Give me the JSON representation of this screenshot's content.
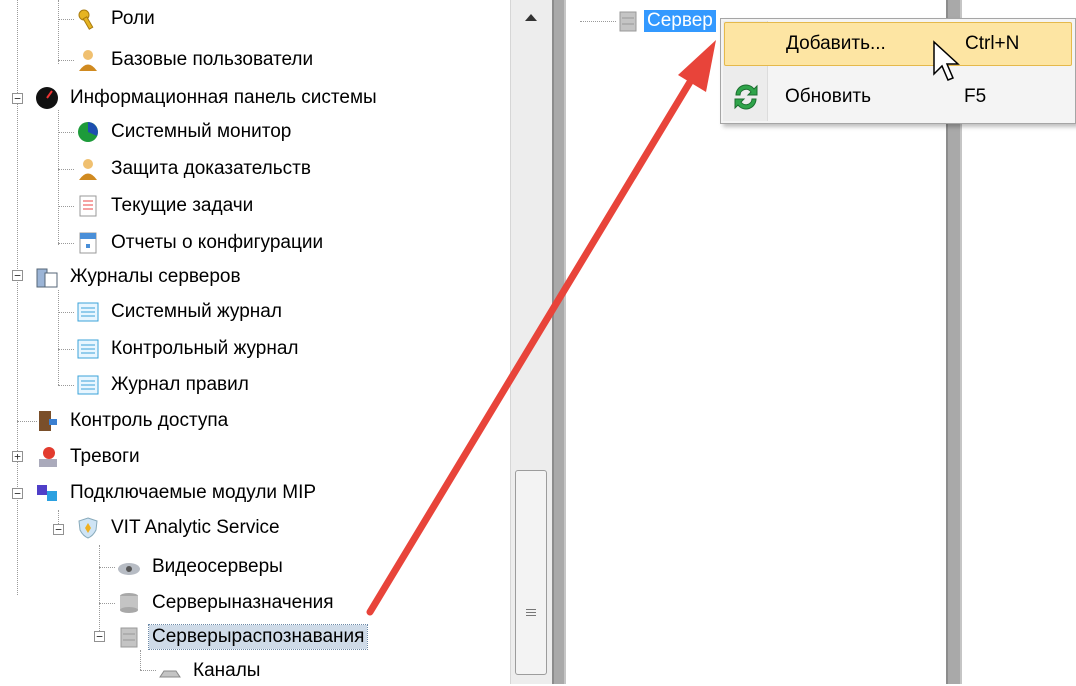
{
  "tree": {
    "items": [
      {
        "label": "Роли",
        "icon": "keys-icon"
      },
      {
        "label": "Базовые пользователи",
        "icon": "user-icon"
      },
      {
        "label": "Информационная панель системы",
        "icon": "dashboard-icon"
      },
      {
        "label": "Системный монитор",
        "icon": "pie-chart-icon"
      },
      {
        "label": "Защита доказательств",
        "icon": "user-lock-icon"
      },
      {
        "label": "Текущие задачи",
        "icon": "task-list-icon"
      },
      {
        "label": "Отчеты о конфигурации",
        "icon": "report-icon"
      },
      {
        "label": "Журналы серверов",
        "icon": "server-logs-icon"
      },
      {
        "label": "Системный журнал",
        "icon": "log-icon"
      },
      {
        "label": "Контрольный журнал",
        "icon": "log-icon"
      },
      {
        "label": "Журнал правил",
        "icon": "log-icon"
      },
      {
        "label": "Контроль доступа",
        "icon": "access-door-icon"
      },
      {
        "label": "Тревоги",
        "icon": "alarm-icon"
      },
      {
        "label": "Подключаемые модули MIP",
        "icon": "plugins-icon"
      },
      {
        "label": "VIT Analytic Service",
        "icon": "shield-icon"
      },
      {
        "label": "Видеосерверы",
        "icon": "camera-icon"
      },
      {
        "label": "Серверыназначения",
        "icon": "database-icon"
      },
      {
        "label": "Серверыраспознавания",
        "icon": "server-icon"
      },
      {
        "label": "Каналы",
        "icon": "channel-icon"
      }
    ],
    "selected": "Серверыраспознавания"
  },
  "middle": {
    "node_label": "Сервер"
  },
  "context_menu": {
    "items": [
      {
        "label": "Добавить...",
        "shortcut": "Ctrl+N",
        "icon": "none"
      },
      {
        "label": "Обновить",
        "shortcut": "F5",
        "icon": "refresh-icon"
      }
    ]
  },
  "colors": {
    "selection": "#3399ff",
    "menu_hover": "#fde5a3",
    "arrow": "#e8443a"
  }
}
